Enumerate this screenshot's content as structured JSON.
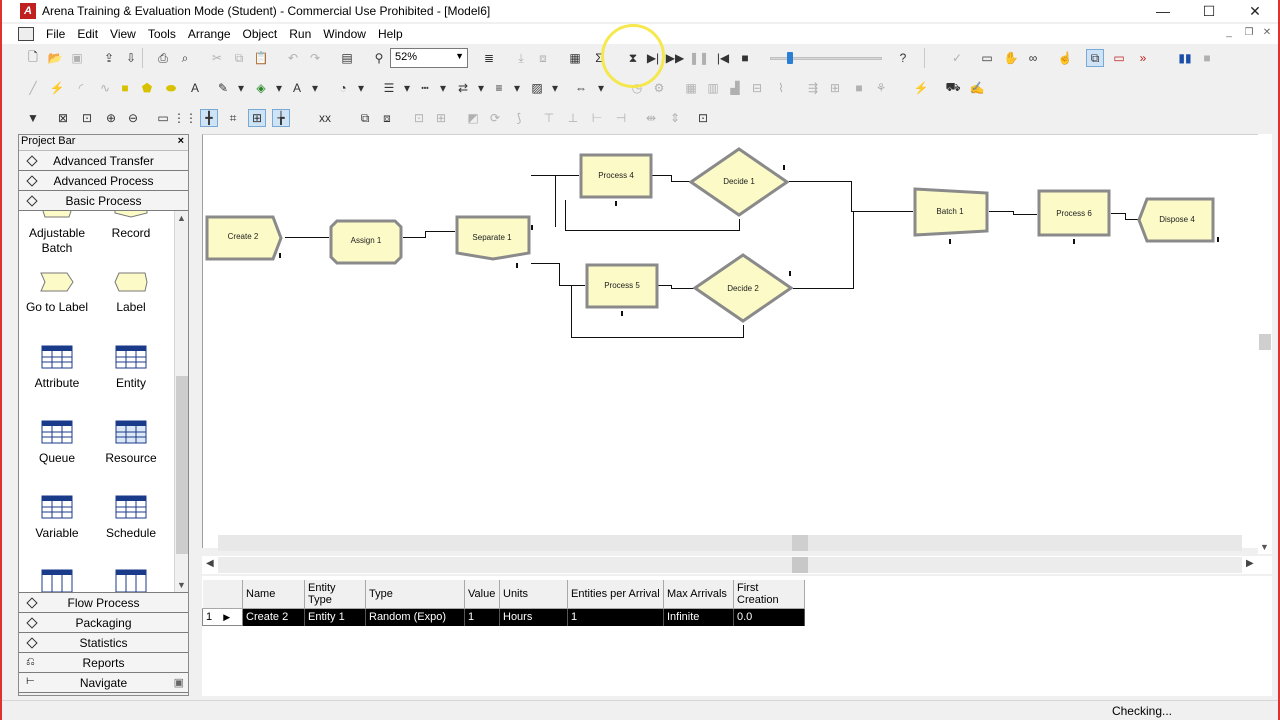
{
  "window": {
    "title": "Arena Training & Evaluation Mode (Student) - Commercial Use Prohibited - [Model6]",
    "controls": {
      "minimize": "—",
      "maximize": "☐",
      "close": "✕"
    }
  },
  "menubar": {
    "items": [
      "File",
      "Edit",
      "View",
      "Tools",
      "Arrange",
      "Object",
      "Run",
      "Window",
      "Help"
    ],
    "mdi_controls": {
      "minimize": "_",
      "restore": "❐",
      "close": "✕"
    }
  },
  "toolbar": {
    "zoom_value": "52%",
    "speed_slider_fraction": 0.15
  },
  "project_bar": {
    "title": "Project Bar",
    "close": "×",
    "top_panels": [
      "Advanced Transfer",
      "Advanced Process",
      "Basic Process"
    ],
    "modules": [
      {
        "label": "Adjustable Batch",
        "icon": "adjustable-batch-icon"
      },
      {
        "label": "Record",
        "icon": "record-icon"
      },
      {
        "label": "Go to Label",
        "icon": "go-to-label-icon"
      },
      {
        "label": "Label",
        "icon": "label-icon"
      },
      {
        "label": "Attribute",
        "icon": "attribute-table-icon"
      },
      {
        "label": "Entity",
        "icon": "entity-table-icon"
      },
      {
        "label": "Queue",
        "icon": "queue-table-icon"
      },
      {
        "label": "Resource",
        "icon": "resource-table-icon"
      },
      {
        "label": "Variable",
        "icon": "variable-table-icon"
      },
      {
        "label": "Schedule",
        "icon": "schedule-table-icon"
      }
    ],
    "bottom_panels": [
      "Flow Process",
      "Packaging",
      "Statistics",
      "Reports",
      "Navigate"
    ]
  },
  "flowchart": {
    "modules": {
      "create": "Create 2",
      "assign": "Assign 1",
      "separate": "Separate 1",
      "process4": "Process 4",
      "decide1": "Decide 1",
      "process5": "Process 5",
      "decide2": "Decide 2",
      "batch": "Batch 1",
      "process6": "Process 6",
      "dispose": "Dispose 4"
    }
  },
  "grid": {
    "columns": [
      "Name",
      "Entity Type",
      "Type",
      "Value",
      "Units",
      "Entities per Arrival",
      "Max Arrivals",
      "First Creation"
    ],
    "row_number": "1",
    "rows": [
      [
        "Create 2",
        "Entity 1",
        "Random (Expo)",
        "1",
        "Hours",
        "1",
        "Infinite",
        "0.0"
      ]
    ]
  },
  "status": {
    "message": "Checking..."
  },
  "colors": {
    "module_fill": "#fcfbc8",
    "module_border": "#8a8a8a",
    "window_border": "#e03030",
    "selected_row": "#000000"
  }
}
